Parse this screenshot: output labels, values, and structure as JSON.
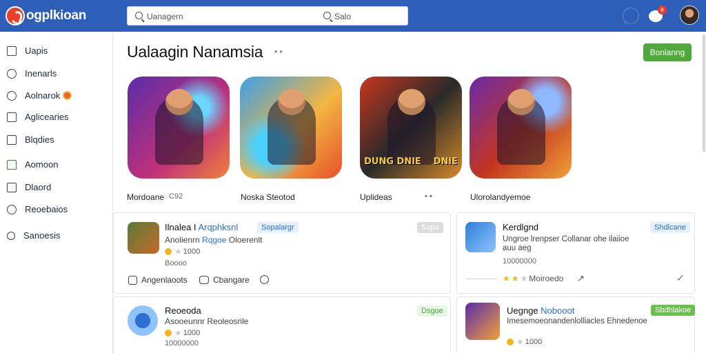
{
  "app": {
    "logo_text": "ogplkioan"
  },
  "search": {
    "placeholder_left": "Uanagern",
    "placeholder_right": "Salo"
  },
  "topbar": {
    "notification_count": "8"
  },
  "sidebar": {
    "items": [
      {
        "label": "Uapis",
        "icon": "grid-icon"
      },
      {
        "label": "Inenarls",
        "icon": "person-icon"
      },
      {
        "label": "Aolnarok",
        "icon": "circle-icon"
      },
      {
        "label": "Aglicearies",
        "icon": "stack-icon"
      },
      {
        "label": "Blqdies",
        "icon": "book-icon"
      },
      {
        "label": "Aomoon",
        "icon": "home-icon"
      },
      {
        "label": "Dlaord",
        "icon": "board-icon"
      },
      {
        "label": "Reoebaios",
        "icon": "people-icon"
      },
      {
        "label": "Sanoesis",
        "icon": "search-icon"
      }
    ]
  },
  "main": {
    "title": "Ualaagin Nanamsia",
    "title_dots": "• •",
    "primary_button": "Bonlanng",
    "featured": [
      {
        "label": "Mordoane",
        "extra": "C92"
      },
      {
        "label": "Noska Steotod",
        "extra": ""
      },
      {
        "label": "Uplideas",
        "extra": "• •"
      },
      {
        "label": "Ulorolandyemoe",
        "extra": ""
      }
    ],
    "featured_banner_left": "DUNG DNIE",
    "featured_banner_right": "DNIE"
  },
  "cards": [
    {
      "name_a": "Ilnalea I",
      "name_b": "Arqphksnl",
      "tag": "Sopalargr",
      "tag2": "Sopo",
      "desc_a": "Anolienrn",
      "desc_b": "Rqgoe",
      "desc_c": "Oloerenlt",
      "count": "Boooo",
      "rating_value": "1000",
      "stars": 1,
      "actions": [
        "Angenlaoots",
        "Cbangare"
      ]
    },
    {
      "name_a": "Kerdlgnd",
      "name_b": "",
      "tag": "Shdlcane",
      "desc_a": "Ungroe lrenpser Collanar ohe ilaiioe",
      "desc_b": "auu aeg",
      "desc_c": "",
      "count": "10000000",
      "rating_label": "Moiroedo",
      "stars": 2
    },
    {
      "name_a": "Reoeoda",
      "name_b": "",
      "tag": "Dsgoe",
      "desc_a": "Asooeunnr",
      "desc_b": "Reoleosrile",
      "desc_c": "",
      "rating_value": "1000",
      "count": "10000000",
      "stars": 1
    },
    {
      "name_a": "Uegnge",
      "name_b": "Nobooot",
      "tag": "Sbdhlakoe",
      "desc_a": "Imesemoeonandenlolliacles Ehnedenoe",
      "desc_b": "",
      "desc_c": "",
      "rating_value": "1000",
      "stars": 1
    }
  ],
  "colors": {
    "brand": "#2d5fb8",
    "accent_green": "#4fa83a",
    "link_blue": "#2d6fd0"
  }
}
